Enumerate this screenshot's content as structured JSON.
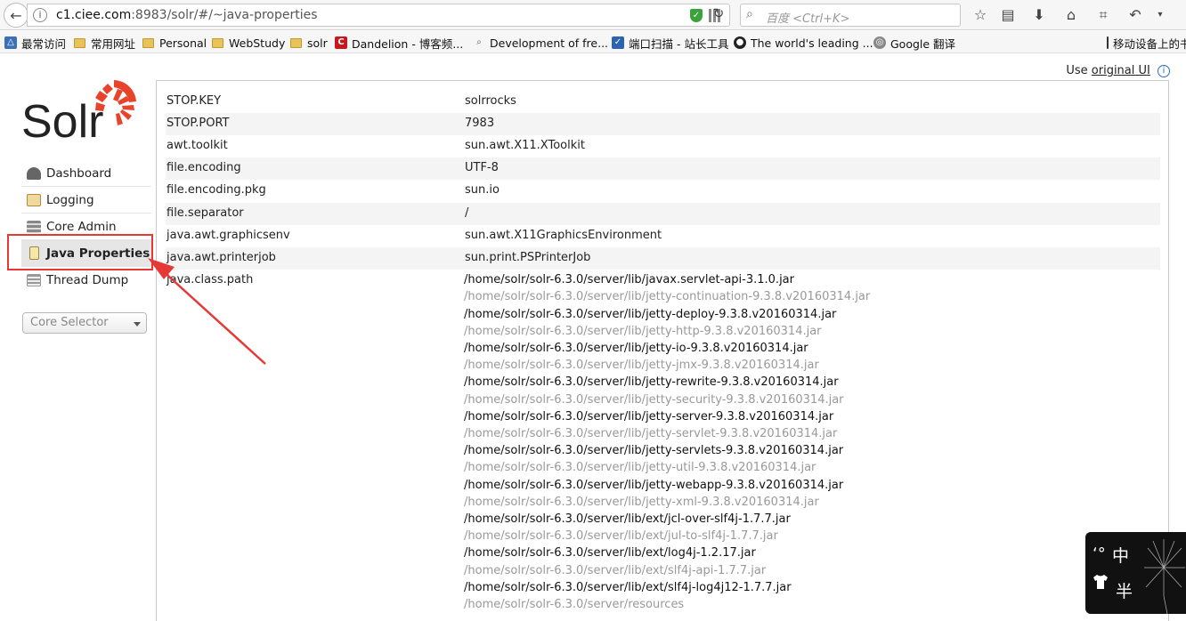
{
  "browser": {
    "url_host": "c1.ciee.com",
    "url_rest": ":8983/solr/#/~java-properties",
    "search_placeholder": "百度 <Ctrl+K>"
  },
  "bookmarks": [
    {
      "label": "最常访问",
      "icon": "most-visited-icon"
    },
    {
      "label": "常用网址",
      "icon": "folder-icon"
    },
    {
      "label": "Personal",
      "icon": "folder-icon"
    },
    {
      "label": "WebStudy",
      "icon": "folder-icon"
    },
    {
      "label": "solr",
      "icon": "folder-icon"
    },
    {
      "label": "Dandelion - 博客频...",
      "icon": "csdn-icon"
    },
    {
      "label": "Development of fre...",
      "icon": "magnifier-icon"
    },
    {
      "label": "端口扫描 - 站长工具",
      "icon": "chinaz-icon"
    },
    {
      "label": "The world's leading ...",
      "icon": "github-icon"
    },
    {
      "label": "Google 翻译",
      "icon": "globe-icon"
    },
    {
      "label": "移动设备上的书",
      "icon": "mobile-icon"
    }
  ],
  "header": {
    "use_text": "Use",
    "original_ui_link": "original UI"
  },
  "logo_text": "Solr",
  "nav": [
    {
      "label": "Dashboard",
      "icon": "dashboard-icon"
    },
    {
      "label": "Logging",
      "icon": "logging-icon"
    },
    {
      "label": "Core Admin",
      "icon": "core-admin-icon"
    },
    {
      "label": "Java Properties",
      "icon": "java-properties-icon"
    },
    {
      "label": "Thread Dump",
      "icon": "thread-dump-icon"
    }
  ],
  "core_selector": "Core Selector",
  "properties": [
    {
      "key": "STOP.KEY",
      "value": "solrrocks"
    },
    {
      "key": "STOP.PORT",
      "value": "7983"
    },
    {
      "key": "awt.toolkit",
      "value": "sun.awt.X11.XToolkit"
    },
    {
      "key": "file.encoding",
      "value": "UTF-8"
    },
    {
      "key": "file.encoding.pkg",
      "value": "sun.io"
    },
    {
      "key": "file.separator",
      "value": "/"
    },
    {
      "key": "java.awt.graphicsenv",
      "value": "sun.awt.X11GraphicsEnvironment"
    },
    {
      "key": "java.awt.printerjob",
      "value": "sun.print.PSPrinterJob"
    },
    {
      "key": "java.class.path",
      "value": ""
    }
  ],
  "classpath": [
    "/home/solr/solr-6.3.0/server/lib/javax.servlet-api-3.1.0.jar",
    "/home/solr/solr-6.3.0/server/lib/jetty-continuation-9.3.8.v20160314.jar",
    "/home/solr/solr-6.3.0/server/lib/jetty-deploy-9.3.8.v20160314.jar",
    "/home/solr/solr-6.3.0/server/lib/jetty-http-9.3.8.v20160314.jar",
    "/home/solr/solr-6.3.0/server/lib/jetty-io-9.3.8.v20160314.jar",
    "/home/solr/solr-6.3.0/server/lib/jetty-jmx-9.3.8.v20160314.jar",
    "/home/solr/solr-6.3.0/server/lib/jetty-rewrite-9.3.8.v20160314.jar",
    "/home/solr/solr-6.3.0/server/lib/jetty-security-9.3.8.v20160314.jar",
    "/home/solr/solr-6.3.0/server/lib/jetty-server-9.3.8.v20160314.jar",
    "/home/solr/solr-6.3.0/server/lib/jetty-servlet-9.3.8.v20160314.jar",
    "/home/solr/solr-6.3.0/server/lib/jetty-servlets-9.3.8.v20160314.jar",
    "/home/solr/solr-6.3.0/server/lib/jetty-util-9.3.8.v20160314.jar",
    "/home/solr/solr-6.3.0/server/lib/jetty-webapp-9.3.8.v20160314.jar",
    "/home/solr/solr-6.3.0/server/lib/jetty-xml-9.3.8.v20160314.jar",
    "/home/solr/solr-6.3.0/server/lib/ext/jcl-over-slf4j-1.7.7.jar",
    "/home/solr/solr-6.3.0/server/lib/ext/jul-to-slf4j-1.7.7.jar",
    "/home/solr/solr-6.3.0/server/lib/ext/log4j-1.2.17.jar",
    "/home/solr/solr-6.3.0/server/lib/ext/slf4j-api-1.7.7.jar",
    "/home/solr/solr-6.3.0/server/lib/ext/slf4j-log4j12-1.7.7.jar",
    "/home/solr/solr-6.3.0/server/resources"
  ],
  "ime_overlay": {
    "punct": "ʻ°",
    "zh": "中",
    "ban": "半"
  },
  "colors": {
    "solr_orange": "#e8442b",
    "highlight_red": "#e53935",
    "active_nav": "#e6e6e6"
  }
}
